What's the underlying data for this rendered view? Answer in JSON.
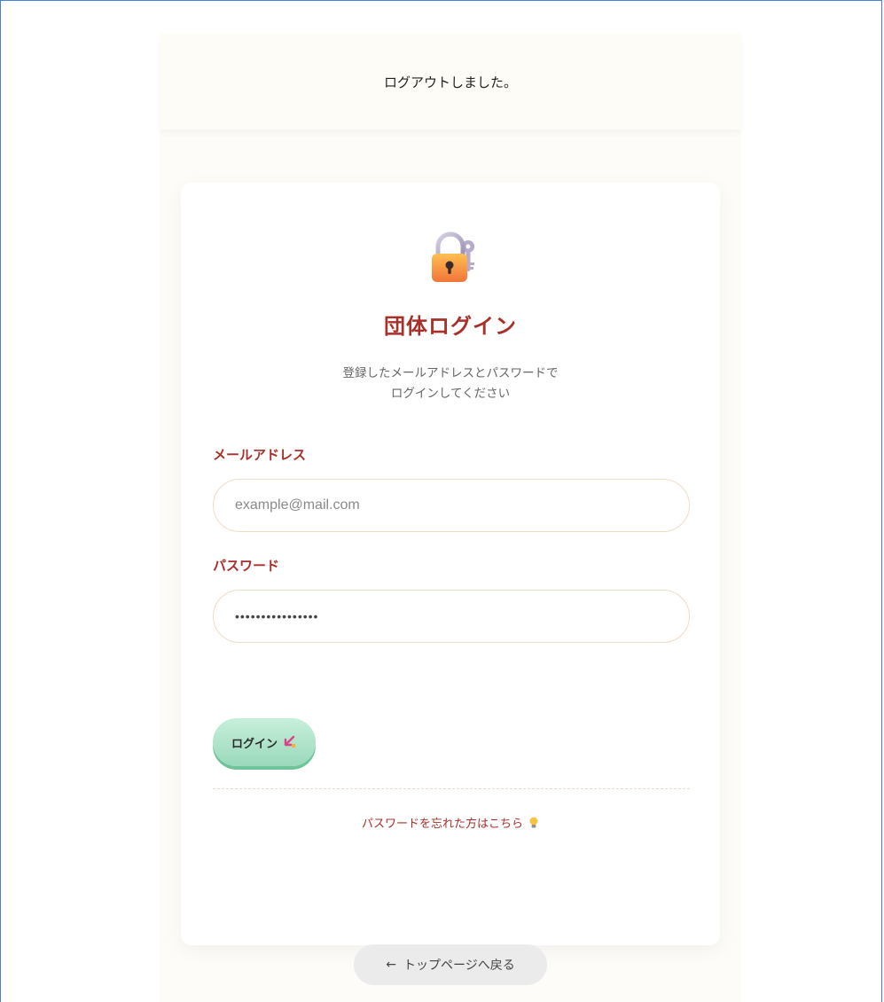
{
  "flash": {
    "message": "ログアウトしました。"
  },
  "login_card": {
    "title": "団体ログイン",
    "subtitle_line1": "登録したメールアドレスとパスワードで",
    "subtitle_line2": "ログインしてください",
    "email_label": "メールアドレス",
    "email_placeholder": "example@mail.com",
    "email_value": "",
    "password_label": "パスワード",
    "password_value": "••••••••••••••••",
    "login_button_label": "ログイン",
    "login_button_icon": "inbox-arrow-icon",
    "forgot_link_text": "パスワードを忘れた方はこちら",
    "forgot_link_icon": "lightbulb-icon",
    "lock_icon": "lock-with-key-icon"
  },
  "back_button": {
    "arrow": "←",
    "label": "トップページへ戻る"
  },
  "colors": {
    "accent_red": "#a8302b",
    "button_green": "#9ad9bb",
    "page_background": "#fdfcf8",
    "frame_blue": "#4a7fd6"
  }
}
